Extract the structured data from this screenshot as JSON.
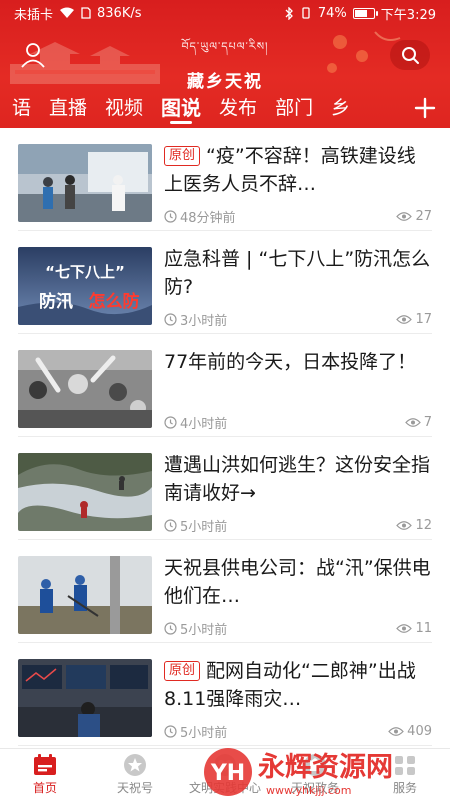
{
  "status_bar": {
    "carrier": "未插卡",
    "speed": "836K/s",
    "battery_percent": "74%",
    "battery_level": 0.74,
    "time": "下午3:29"
  },
  "header": {
    "logo_tibetan": "བོད་ཡུལ་དཔལ་རིས།",
    "logo_chinese": "藏乡天祝",
    "brand_color": "#d81e1e"
  },
  "tabs": [
    {
      "label": "语"
    },
    {
      "label": "直播"
    },
    {
      "label": "视频"
    },
    {
      "label": "图说"
    },
    {
      "label": "发布"
    },
    {
      "label": "部门"
    },
    {
      "label": "乡"
    }
  ],
  "active_tab": "图说",
  "articles": [
    {
      "badge": "原创",
      "title": "“疫”不容辞！高铁建设线上医务人员不辞…",
      "time": "48分钟前",
      "views": "27"
    },
    {
      "badge": "",
      "title": "应急科普 | “七下八上”防汛怎么防?",
      "time": "3小时前",
      "views": "17",
      "thumb_text_1": "“七下八上”",
      "thumb_text_2": "防汛",
      "thumb_text_3": "怎么防"
    },
    {
      "badge": "",
      "title": "77年前的今天，日本投降了！",
      "time": "4小时前",
      "views": "7"
    },
    {
      "badge": "",
      "title": "遭遇山洪如何逃生？这份安全指南请收好→",
      "time": "5小时前",
      "views": "12"
    },
    {
      "badge": "",
      "title": "天祝县供电公司：战“汛”保供电 他们在…",
      "time": "5小时前",
      "views": "11"
    },
    {
      "badge": "原创",
      "title": "配网自动化“二郎神”出战8.11强降雨灾…",
      "time": "5小时前",
      "views": "409"
    }
  ],
  "bottom_nav": [
    {
      "label": "首页",
      "icon": "calendar-home-icon",
      "active": true
    },
    {
      "label": "天祝号",
      "icon": "star-icon",
      "active": false
    },
    {
      "label": "文明实践中心",
      "icon": "heart-center-icon",
      "active": false
    },
    {
      "label": "天祝政务",
      "icon": "gov-icon",
      "active": false
    },
    {
      "label": "服务",
      "icon": "service-icon",
      "active": false
    }
  ],
  "watermark": {
    "text": "永辉资源网",
    "url_text": "www.yhkjjj.com"
  }
}
